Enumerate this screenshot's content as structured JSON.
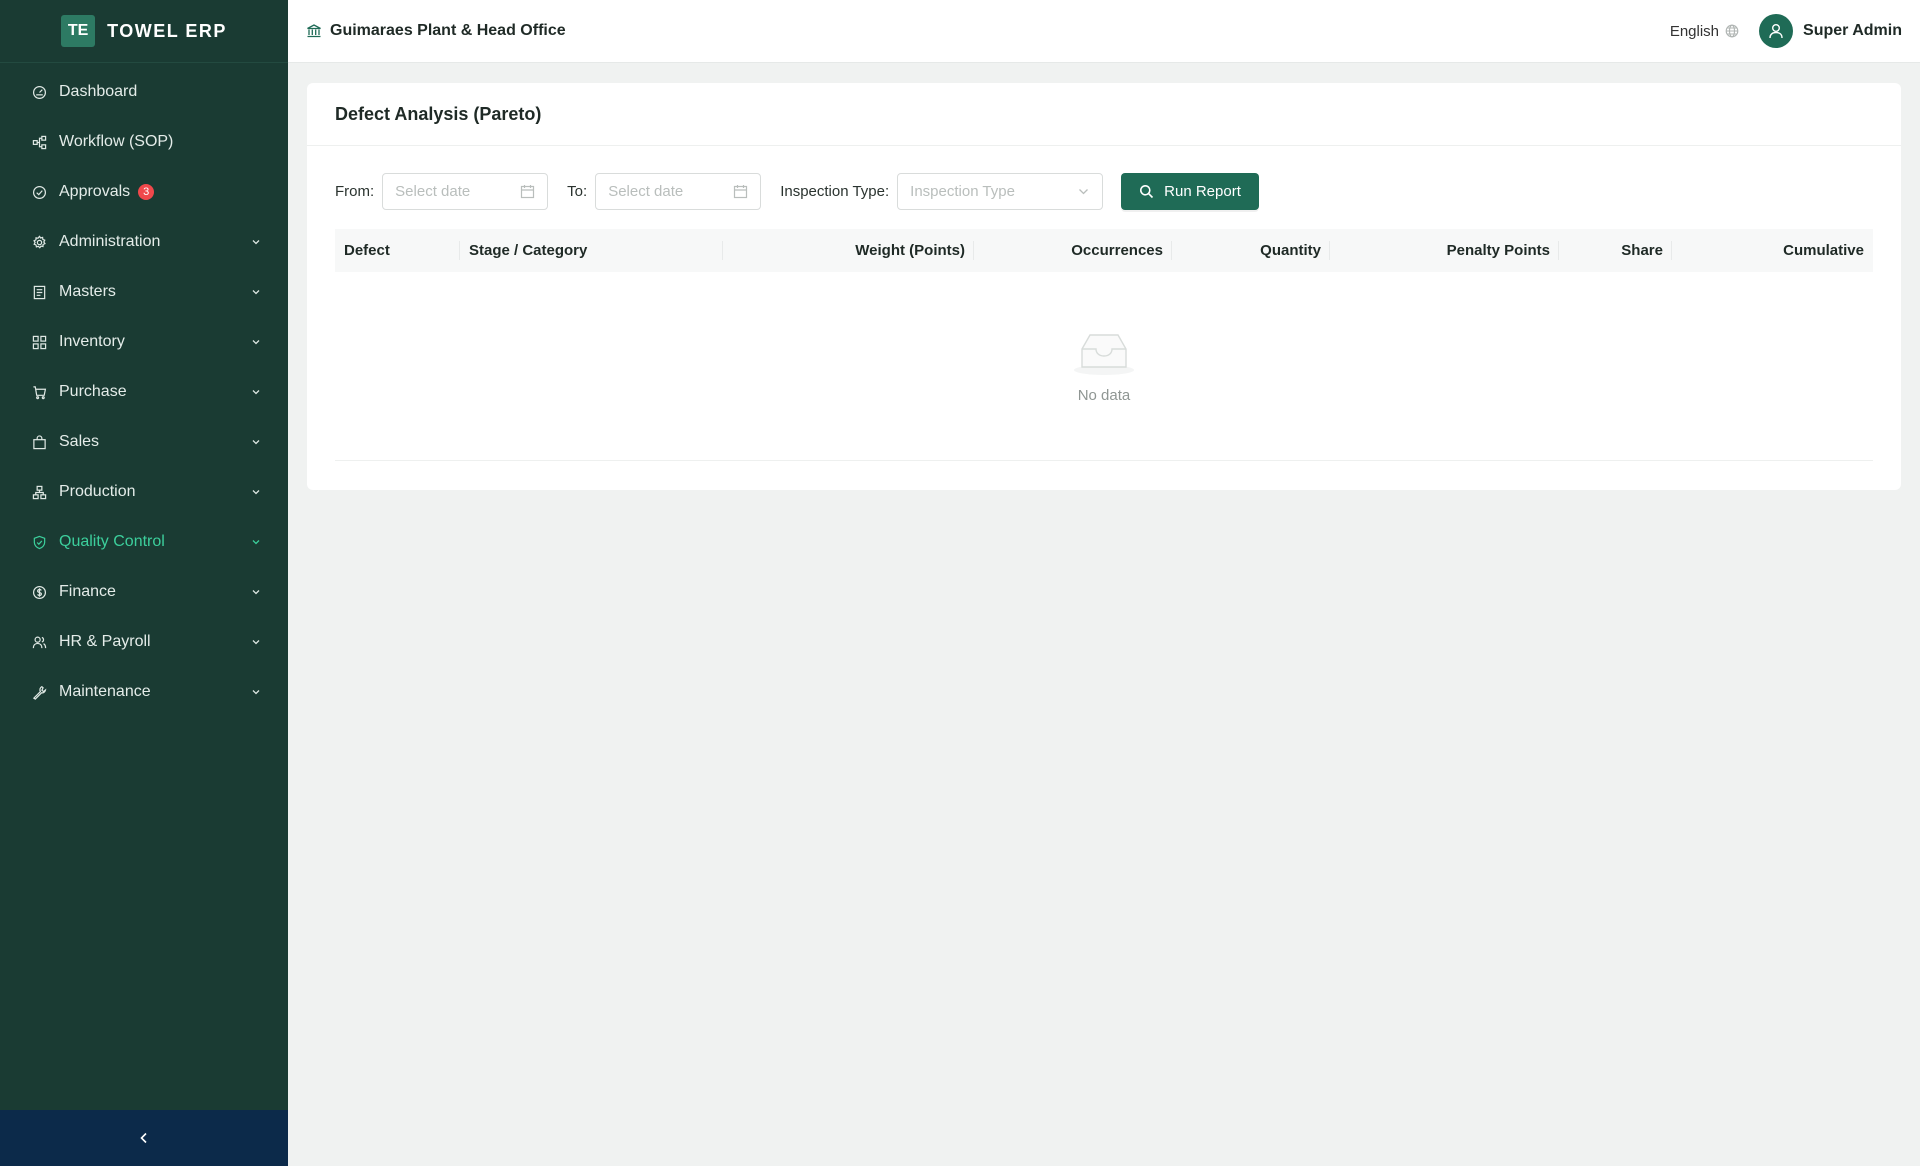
{
  "brand": {
    "logo_text": "TE",
    "name": "TOWEL ERP"
  },
  "sidebar": {
    "items": [
      {
        "label": "Dashboard",
        "icon": "dashboard-icon",
        "has_children": false
      },
      {
        "label": "Workflow (SOP)",
        "icon": "workflow-icon",
        "has_children": false
      },
      {
        "label": "Approvals",
        "icon": "check-circle-icon",
        "has_children": false,
        "badge": "3"
      },
      {
        "label": "Administration",
        "icon": "gear-icon",
        "has_children": true
      },
      {
        "label": "Masters",
        "icon": "book-icon",
        "has_children": true
      },
      {
        "label": "Inventory",
        "icon": "grid-icon",
        "has_children": true
      },
      {
        "label": "Purchase",
        "icon": "cart-icon",
        "has_children": true
      },
      {
        "label": "Sales",
        "icon": "bag-icon",
        "has_children": true
      },
      {
        "label": "Production",
        "icon": "hierarchy-icon",
        "has_children": true
      },
      {
        "label": "Quality Control",
        "icon": "shield-check-icon",
        "has_children": true,
        "active": true
      },
      {
        "label": "Finance",
        "icon": "dollar-icon",
        "has_children": true
      },
      {
        "label": "HR & Payroll",
        "icon": "people-icon",
        "has_children": true
      },
      {
        "label": "Maintenance",
        "icon": "wrench-icon",
        "has_children": true
      }
    ],
    "collapse_icon": "chevron-left-icon"
  },
  "topbar": {
    "plant": "Guimaraes Plant & Head Office",
    "language": "English",
    "user": "Super Admin"
  },
  "page": {
    "title": "Defect Analysis (Pareto)",
    "filters": {
      "from_label": "From",
      "from_placeholder": "Select date",
      "to_label": "To",
      "to_placeholder": "Select date",
      "inspection_label": "Inspection Type",
      "inspection_placeholder": "Inspection Type",
      "run_label": "Run Report"
    },
    "table": {
      "columns": [
        "Defect",
        "Stage / Category",
        "Weight (Points)",
        "Occurrences",
        "Quantity",
        "Penalty Points",
        "Share",
        "Cumulative"
      ],
      "empty_text": "No data"
    }
  },
  "colors": {
    "sidebar_bg": "#1a3b33",
    "accent": "#1f6b56",
    "active_menu": "#3ccf9c",
    "badge": "#f0484b",
    "collapse_bar": "#0c2a4a"
  }
}
